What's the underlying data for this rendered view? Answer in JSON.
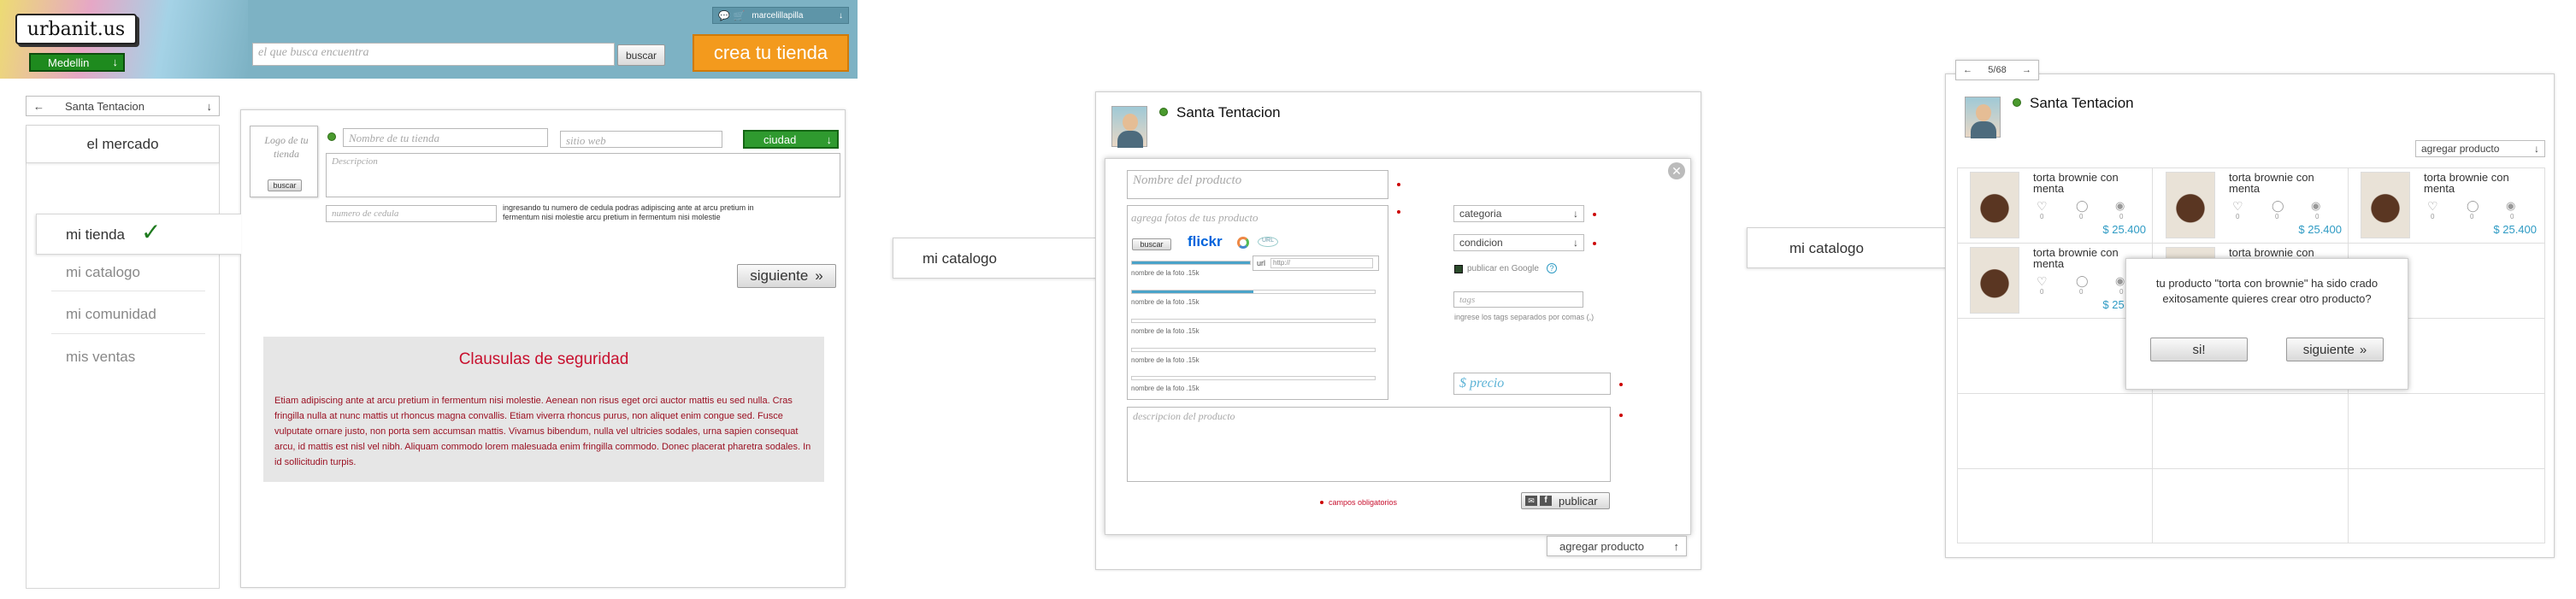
{
  "header": {
    "logo": "urbanit.us",
    "city": "Medellin",
    "search_placeholder": "el que busca encuentra",
    "search_button": "buscar",
    "cta": "crea tu tienda",
    "user": "marcelillapilla",
    "colors": {
      "cta": "#f39a1d",
      "city": "#1e8a1e",
      "bar": "#7db2c4"
    }
  },
  "store_selector": {
    "name": "Santa Tentacion"
  },
  "sidebar": {
    "market": "el mercado",
    "items": [
      "mi tienda",
      "mi catalogo",
      "mi comunidad",
      "mis ventas"
    ],
    "check": "✓"
  },
  "store_form": {
    "logo_label": "Logo de tu tienda",
    "logo_button": "buscar",
    "name_placeholder": "Nombre de tu tienda",
    "web_placeholder": "sitio web",
    "city_select": "ciudad",
    "description_placeholder": "Descripcion",
    "id_placeholder": "numero de cedula",
    "id_help": "ingresando tu numero de cedula podras adipiscing ante at arcu pretium in fermentum nisi molestie arcu pretium in fermentum nisi molestie",
    "next_button": "siguiente"
  },
  "security": {
    "title": "Clausulas de seguridad",
    "body": "Etiam adipiscing ante at arcu pretium in fermentum nisi molestie. Aenean non risus eget orci auctor mattis eu sed nulla. Cras fringilla nulla at nunc mattis ut rhoncus magna convallis. Etiam viverra rhoncus purus, non aliquet enim congue sed. Fusce vulputate ornare justo, non porta sem accumsan mattis. Vivamus bibendum, nulla vel ultricies sodales, urna sapien consequat arcu, id mattis est nisl vel nibh. Aliquam commodo lorem malesuada enim fringilla commodo. Donec placerat pharetra sodales. In id sollicitudin turpis.",
    "colors": {
      "title": "#c8102e",
      "bg": "#e6e6e6"
    }
  },
  "screen2": {
    "store": "Santa Tentacion",
    "side_label": "mi catalogo",
    "product_name": "Nombre del producto",
    "photos_label": "agrega fotos de tus producto",
    "photo_search": "buscar",
    "flickr": "flickr",
    "url_label": "url",
    "url_value": "http://",
    "photo_rows": [
      "nombre de la foto .15k",
      "nombre de la foto .15k",
      "nombre de la foto .15k",
      "nombre de la foto .15k",
      "nombre de la foto .15k"
    ],
    "category": "categoria",
    "condition": "condicion",
    "google": "publicar en Google",
    "google_help": "?",
    "tags": "tags",
    "tags_help": "ingrese los tags separados por comas (,)",
    "price": "$ precio",
    "description": "descripcion del producto",
    "required": "campos obligatorios",
    "publish": "publicar",
    "add_product": "agregar producto"
  },
  "screen3": {
    "store": "Santa Tentacion",
    "side_label": "mi catalogo",
    "pager": "5/68",
    "add_product": "agregar producto",
    "products": [
      {
        "title": "torta brownie con menta",
        "price": "$ 25.400"
      },
      {
        "title": "torta brownie con menta",
        "price": "$ 25.400"
      },
      {
        "title": "torta brownie con menta",
        "price": "$ 25.400"
      },
      {
        "title": "torta brownie con menta",
        "price": "$ 25.400"
      },
      {
        "title": "torta brownie con menta",
        "price": ""
      }
    ],
    "stat": "0",
    "dialog": {
      "text_a": "tu producto ",
      "quoted": "\"torta con brownie\"",
      "text_b": " ha sido crado exitosamente quieres crear otro producto?",
      "yes": "si!",
      "next": "siguiente"
    }
  }
}
